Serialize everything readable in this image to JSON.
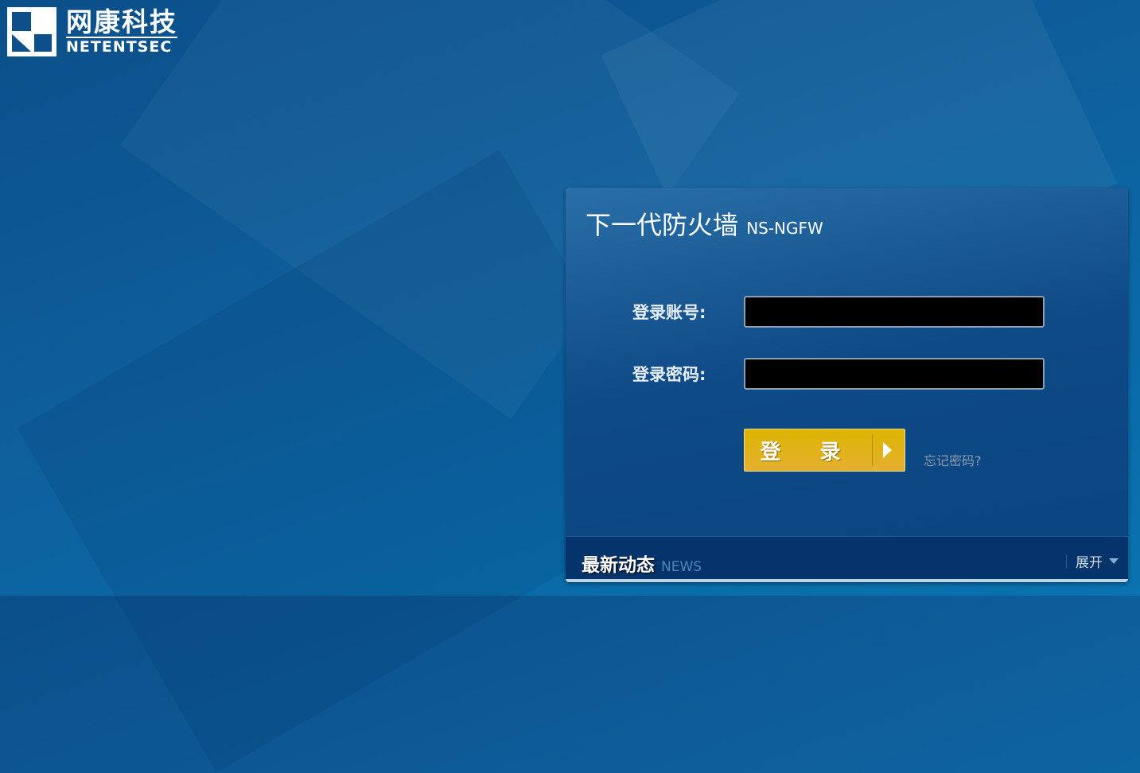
{
  "brand": {
    "name_cn": "网康科技",
    "name_en": "NETENTSEC"
  },
  "login": {
    "title": "下一代防火墙",
    "subtitle": "NS-NGFW",
    "username_label": "登录账号:",
    "username_value": "",
    "password_label": "登录密码:",
    "password_value": "",
    "submit_label": "登 录",
    "forgot_label": "忘记密码?"
  },
  "news": {
    "title": "最新动态",
    "title_en": "NEWS",
    "expand_label": "展开"
  },
  "colors": {
    "background": "#0e5f9c",
    "button": "#dcb400",
    "input": "#000000"
  }
}
